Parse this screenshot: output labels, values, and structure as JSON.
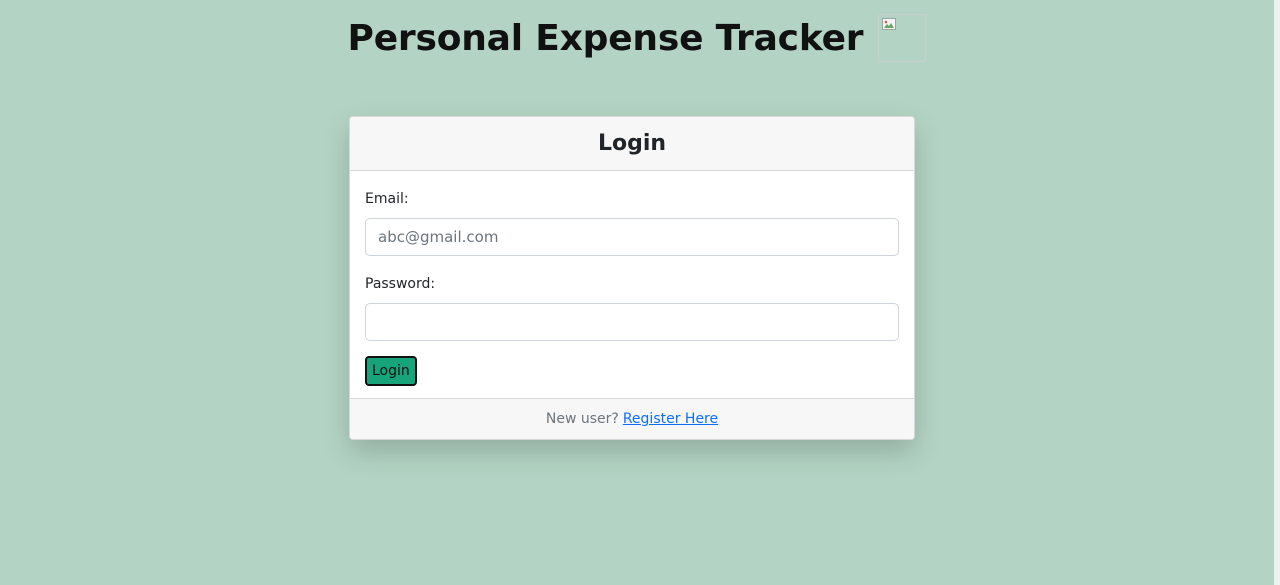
{
  "header": {
    "title": "Personal Expense Tracker",
    "logo_icon": "broken-image-icon"
  },
  "login_card": {
    "title": "Login",
    "email_label": "Email:",
    "email_placeholder": "abc@gmail.com",
    "email_value": "",
    "password_label": "Password:",
    "password_value": "",
    "submit_label": "Login",
    "footer_prompt": "New user?",
    "register_link": "Register Here"
  },
  "colors": {
    "background": "#b3d4c4",
    "button": "#17a47a",
    "link": "#0d6efd"
  }
}
